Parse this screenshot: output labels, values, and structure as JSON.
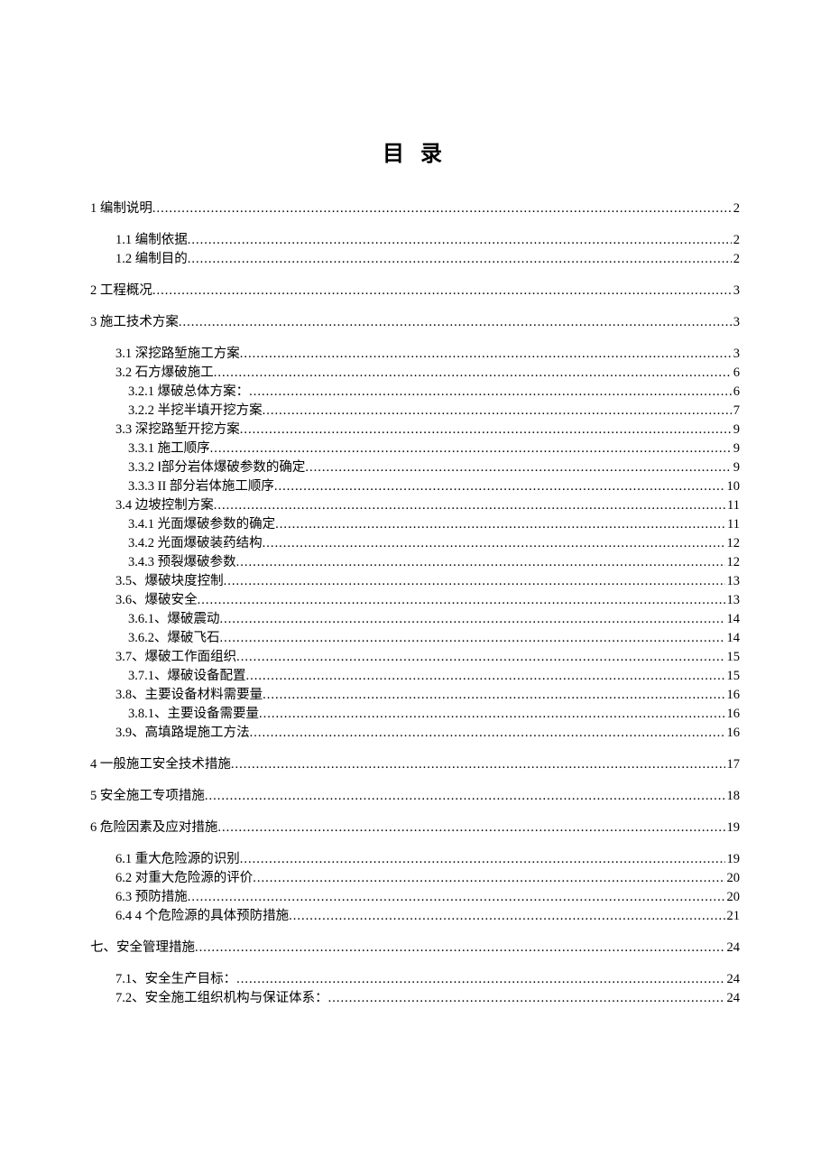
{
  "title": "目 录",
  "toc": [
    {
      "level": 1,
      "text": "1 编制说明 ",
      "page": "2",
      "gap_before": false
    },
    {
      "level": 2,
      "text": "1.1 编制依据",
      "page": "2",
      "gap_before": true
    },
    {
      "level": 2,
      "text": "1.2 编制目的",
      "page": "2",
      "gap_before": false
    },
    {
      "level": 1,
      "text": "2 工程概况",
      "page": "3",
      "gap_before": true
    },
    {
      "level": 1,
      "text": "3 施工技术方案",
      "page": "3",
      "gap_before": true
    },
    {
      "level": 2,
      "text": "3.1 深挖路堑施工方案 ",
      "page": "3",
      "gap_before": true
    },
    {
      "level": 2,
      "text": "3.2 石方爆破施工 ",
      "page": "6",
      "gap_before": false
    },
    {
      "level": 3,
      "text": "3.2.1 爆破总体方案： ",
      "page": "6",
      "gap_before": false
    },
    {
      "level": 3,
      "text": "3.2.2 半挖半填开挖方案 ",
      "page": "7",
      "gap_before": false
    },
    {
      "level": 2,
      "text": "3.3 深挖路堑开挖方案 ",
      "page": "9",
      "gap_before": false
    },
    {
      "level": 3,
      "text": "3.3.1 施工顺序 ",
      "page": "9",
      "gap_before": false
    },
    {
      "level": 3,
      "text": "3.3.2  Ⅰ部分岩体爆破参数的确定 ",
      "page": "9",
      "gap_before": false
    },
    {
      "level": 3,
      "text": "3.3.3  II 部分岩体施工顺序 ",
      "page": "10",
      "gap_before": false
    },
    {
      "level": 2,
      "text": "3.4 边坡控制方案 ",
      "page": "11",
      "gap_before": false
    },
    {
      "level": 3,
      "text": "3.4.1 光面爆破参数的确定",
      "page": "11",
      "gap_before": false
    },
    {
      "level": 3,
      "text": "3.4.2 光面爆破装药结构",
      "page": "12",
      "gap_before": false
    },
    {
      "level": 3,
      "text": "3.4.3 预裂爆破参数",
      "page": "12",
      "gap_before": false
    },
    {
      "level": 2,
      "text": "3.5、爆破块度控制",
      "page": "13",
      "gap_before": false
    },
    {
      "level": 2,
      "text": "3.6、爆破安全",
      "page": "13",
      "gap_before": false
    },
    {
      "level": 3,
      "text": "3.6.1、爆破震动",
      "page": "14",
      "gap_before": false
    },
    {
      "level": 3,
      "text": "3.6.2、爆破飞石",
      "page": "14",
      "gap_before": false
    },
    {
      "level": 2,
      "text": "3.7、爆破工作面组织",
      "page": "15",
      "gap_before": false
    },
    {
      "level": 3,
      "text": "3.7.1、爆破设备配置",
      "page": "15",
      "gap_before": false
    },
    {
      "level": 2,
      "text": "3.8、主要设备材料需要量",
      "page": "16",
      "gap_before": false
    },
    {
      "level": 3,
      "text": "3.8.1、主要设备需要量",
      "page": "16",
      "gap_before": false
    },
    {
      "level": 2,
      "text": "3.9、高填路堤施工方法",
      "page": "16",
      "gap_before": false
    },
    {
      "level": 1,
      "text": "4 一般施工安全技术措施",
      "page": "17",
      "gap_before": true
    },
    {
      "level": 1,
      "text": "5 安全施工专项措施",
      "page": "18",
      "gap_before": true
    },
    {
      "level": 1,
      "text": "6 危险因素及应对措施",
      "page": "19",
      "gap_before": true
    },
    {
      "level": 2,
      "text": "6.1 重大危险源的识别",
      "page": "19",
      "gap_before": true
    },
    {
      "level": 2,
      "text": "6.2 对重大危险源的评价",
      "page": "20",
      "gap_before": false
    },
    {
      "level": 2,
      "text": "6.3 预防措施 ",
      "page": "20",
      "gap_before": false
    },
    {
      "level": 2,
      "text": "6.4  4 个危险源的具体预防措施",
      "page": "21",
      "gap_before": false
    },
    {
      "level": 1,
      "text": "七、安全管理措施 ",
      "page": "24",
      "gap_before": true
    },
    {
      "level": 2,
      "text": "7.1、安全生产目标： ",
      "page": "24",
      "gap_before": true
    },
    {
      "level": 2,
      "text": "7.2、安全施工组织机构与保证体系： ",
      "page": "24",
      "gap_before": false
    }
  ]
}
